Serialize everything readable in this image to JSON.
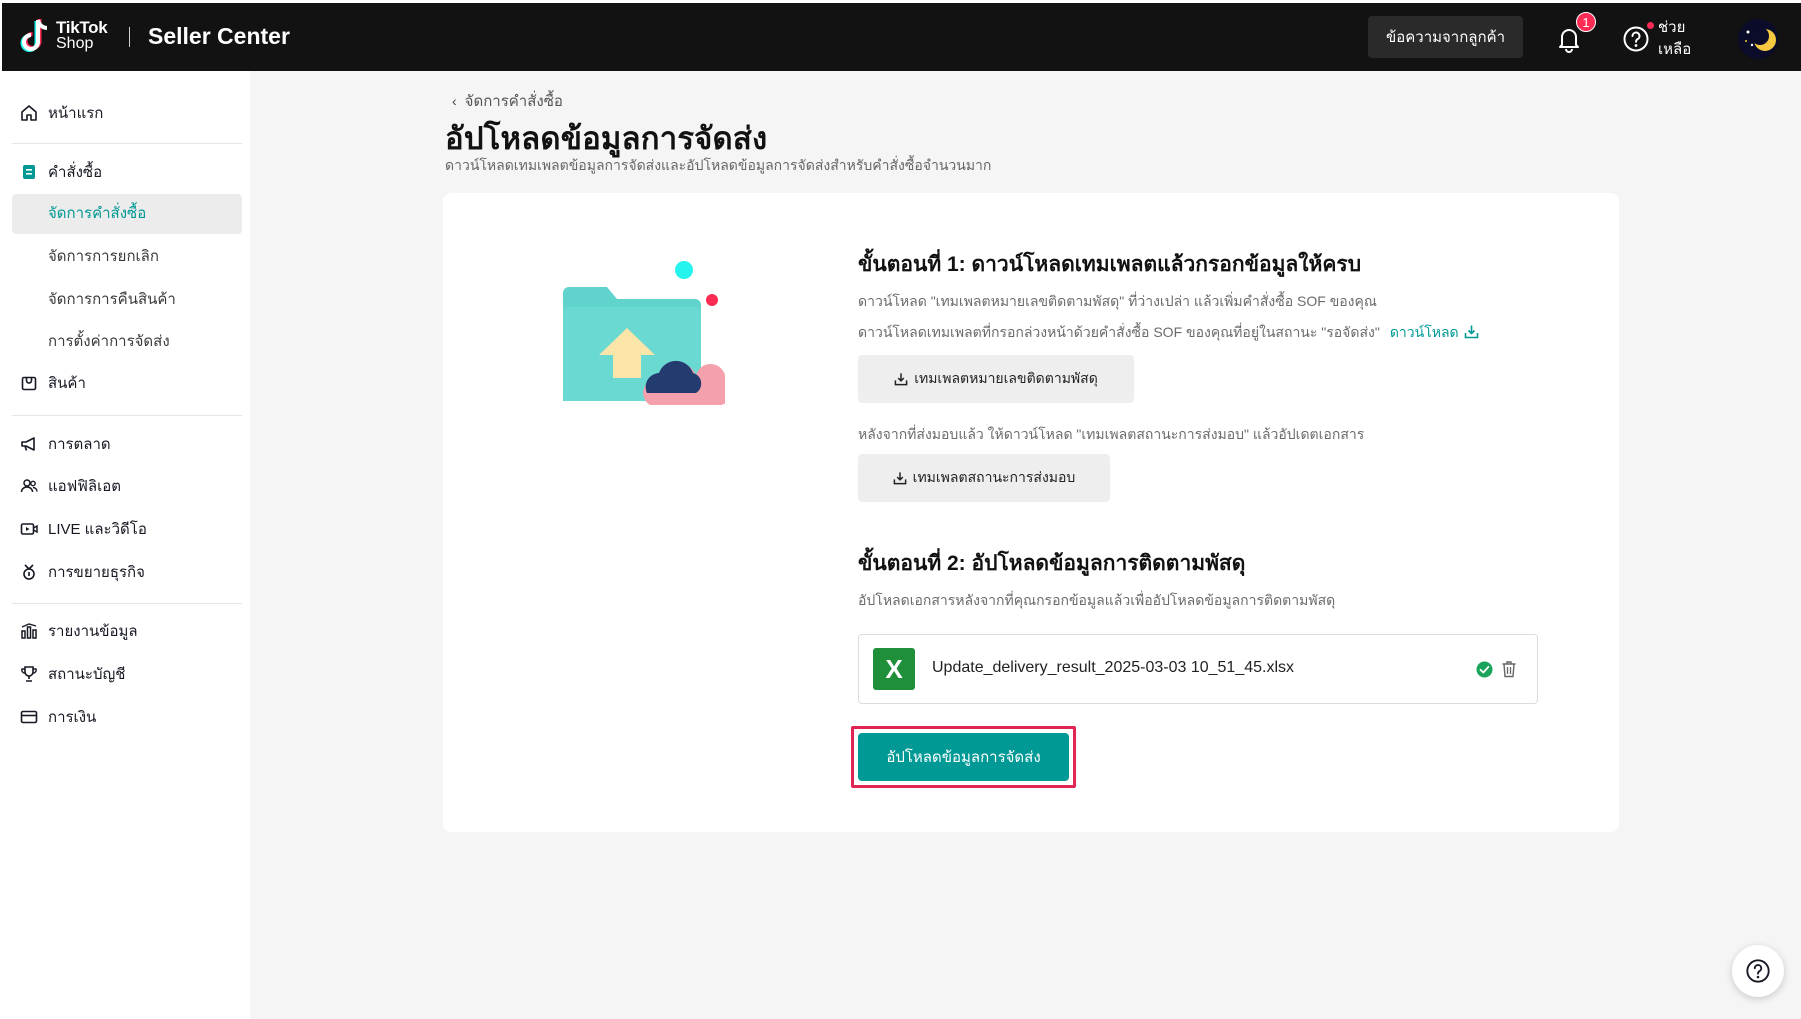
{
  "header": {
    "logo_line1": "TikTok",
    "logo_line2": "Shop",
    "app_title": "Seller Center",
    "messages_label": "ข้อความจากลูกค้า",
    "notification_count": "1",
    "help_label": "ช่วยเหลือ"
  },
  "sidebar": {
    "home": "หน้าแรก",
    "orders": "คำสั่งซื้อ",
    "orders_sub": [
      "จัดการคำสั่งซื้อ",
      "จัดการการยกเลิก",
      "จัดการการคืนสินค้า",
      "การตั้งค่าการจัดส่ง"
    ],
    "products": "สินค้า",
    "marketing": "การตลาด",
    "affiliate": "แอฟฟิลิเอต",
    "live_video": "LIVE และวิดีโอ",
    "growth": "การขยายธุรกิจ",
    "reports": "รายงานข้อมูล",
    "account_status": "สถานะบัญชี",
    "finance": "การเงิน"
  },
  "page": {
    "breadcrumb": "จัดการคำสั่งซื้อ",
    "title": "อัปโหลดข้อมูลการจัดส่ง",
    "subtitle": "ดาวน์โหลดเทมเพลตข้อมูลการจัดส่งและอัปโหลดข้อมูลการจัดส่งสำหรับคำสั่งซื้อจำนวนมาก"
  },
  "step1": {
    "title": "ขั้นตอนที่ 1: ดาวน์โหลดเทมเพลตแล้วกรอกข้อมูลให้ครบ",
    "desc1": "ดาวน์โหลด \"เทมเพลตหมายเลขติดตามพัสดุ\" ที่ว่างเปล่า แล้วเพิ่มคำสั่งซื้อ SOF ของคุณ",
    "desc2": "ดาวน์โหลดเทมเพลตที่กรอกล่วงหน้าด้วยคำสั่งซื้อ SOF ของคุณที่อยู่ในสถานะ \"รอจัดส่ง\"",
    "download_link": "ดาวน์โหลด",
    "tracking_template_btn": "เทมเพลตหมายเลขติดตามพัสดุ",
    "desc3": "หลังจากที่ส่งมอบแล้ว ให้ดาวน์โหลด \"เทมเพลตสถานะการส่งมอบ\" แล้วอัปเดตเอกสาร",
    "delivery_status_btn": "เทมเพลตสถานะการส่งมอบ"
  },
  "step2": {
    "title": "ขั้นตอนที่ 2: อัปโหลดข้อมูลการติดตามพัสดุ",
    "desc": "อัปโหลดเอกสารหลังจากที่คุณกรอกข้อมูลแล้วเพื่ออัปโหลดข้อมูลการติดตามพัสดุ",
    "file_icon_letter": "X",
    "file_name": "Update_delivery_result_2025-03-03 10_51_45.xlsx",
    "upload_btn": "อัปโหลดข้อมูลการจัดส่ง"
  },
  "colors": {
    "accent": "#009995",
    "highlight": "#e02454",
    "topbar": "#121212"
  }
}
